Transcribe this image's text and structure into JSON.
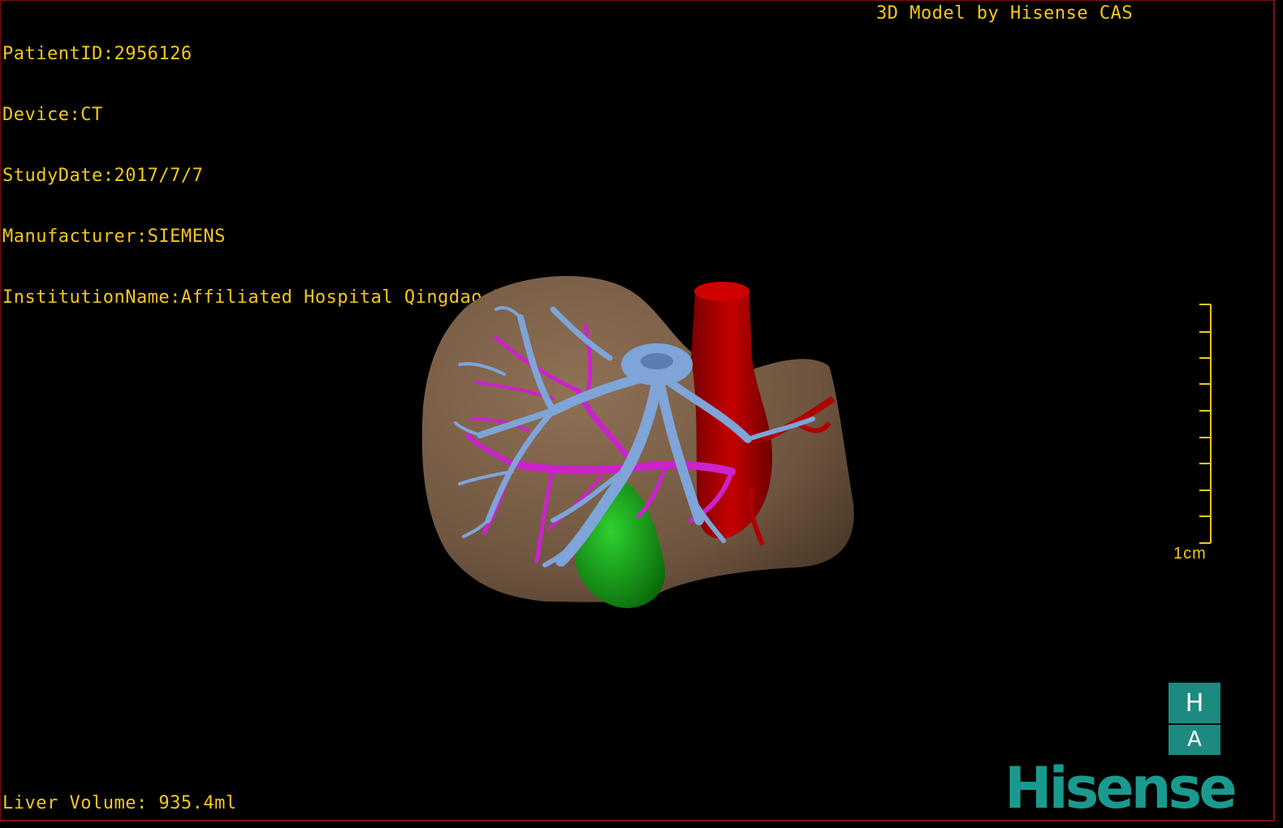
{
  "info": {
    "patient_id": "PatientID:2956126",
    "device": "Device:CT",
    "study_date": "StudyDate:2017/7/7",
    "manufacturer": "Manufacturer:SIEMENS",
    "institution": "InstitutionName:Affiliated Hospital Qingdao University-C"
  },
  "brand_text": "3D Model by Hisense CAS",
  "liver_volume": "Liver Volume: 935.4ml",
  "scale": {
    "label": "1cm"
  },
  "badge": {
    "top": "H",
    "bottom": "A"
  },
  "logo": "Hisense",
  "colors": {
    "overlay_text": "#f2c81a",
    "liver": "#7d6248",
    "portal_vein": "#7ea4d8",
    "hepatic_artery": "#cc22cc",
    "ivc": "#b00000",
    "gallbladder": "#1aa51a",
    "brand": "#1a9a8e"
  }
}
